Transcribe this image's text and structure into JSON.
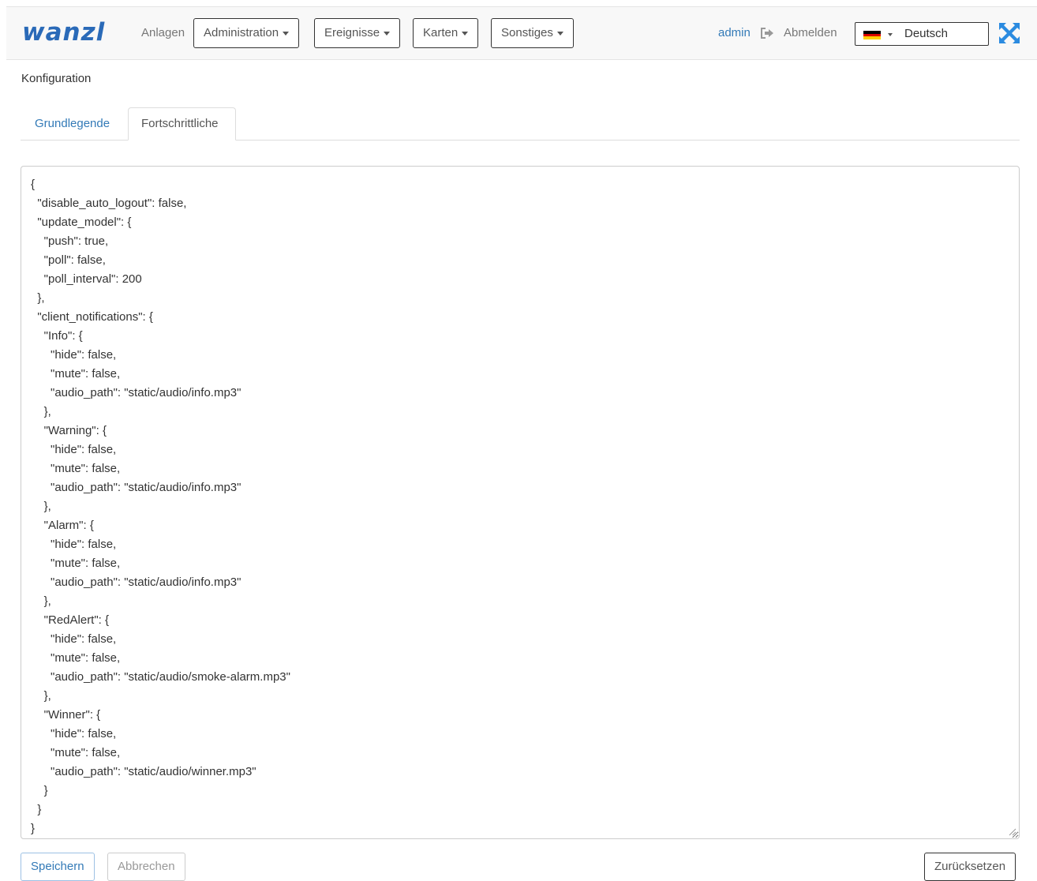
{
  "header": {
    "logo": "wanzl",
    "nav_plants": "Anlagen",
    "menus": [
      "Administration",
      "Ereignisse",
      "Karten",
      "Sonstiges"
    ],
    "user": "admin",
    "logout_label": "Abmelden",
    "language": "Deutsch"
  },
  "page": {
    "title": "Konfiguration",
    "tabs": [
      "Grundlegende",
      "Fortschrittliche"
    ],
    "active_tab": "Fortschrittliche"
  },
  "editor": {
    "content": "{\n  \"disable_auto_logout\": false,\n  \"update_model\": {\n    \"push\": true,\n    \"poll\": false,\n    \"poll_interval\": 200\n  },\n  \"client_notifications\": {\n    \"Info\": {\n      \"hide\": false,\n      \"mute\": false,\n      \"audio_path\": \"static/audio/info.mp3\"\n    },\n    \"Warning\": {\n      \"hide\": false,\n      \"mute\": false,\n      \"audio_path\": \"static/audio/info.mp3\"\n    },\n    \"Alarm\": {\n      \"hide\": false,\n      \"mute\": false,\n      \"audio_path\": \"static/audio/info.mp3\"\n    },\n    \"RedAlert\": {\n      \"hide\": false,\n      \"mute\": false,\n      \"audio_path\": \"static/audio/smoke-alarm.mp3\"\n    },\n    \"Winner\": {\n      \"hide\": false,\n      \"mute\": false,\n      \"audio_path\": \"static/audio/winner.mp3\"\n    }\n  }\n}"
  },
  "actions": {
    "save": "Speichern",
    "cancel": "Abbrechen",
    "reset": "Zurücksetzen"
  },
  "icons": {
    "logout": "logout-icon",
    "flag": "german-flag-icon",
    "fullscreen": "fullscreen-icon"
  },
  "colors": {
    "brand": "#2a6ab8",
    "link": "#337ab7",
    "fullscreen": "#2b8be0",
    "flag": [
      "#000000",
      "#dd0000",
      "#ffce00"
    ]
  }
}
